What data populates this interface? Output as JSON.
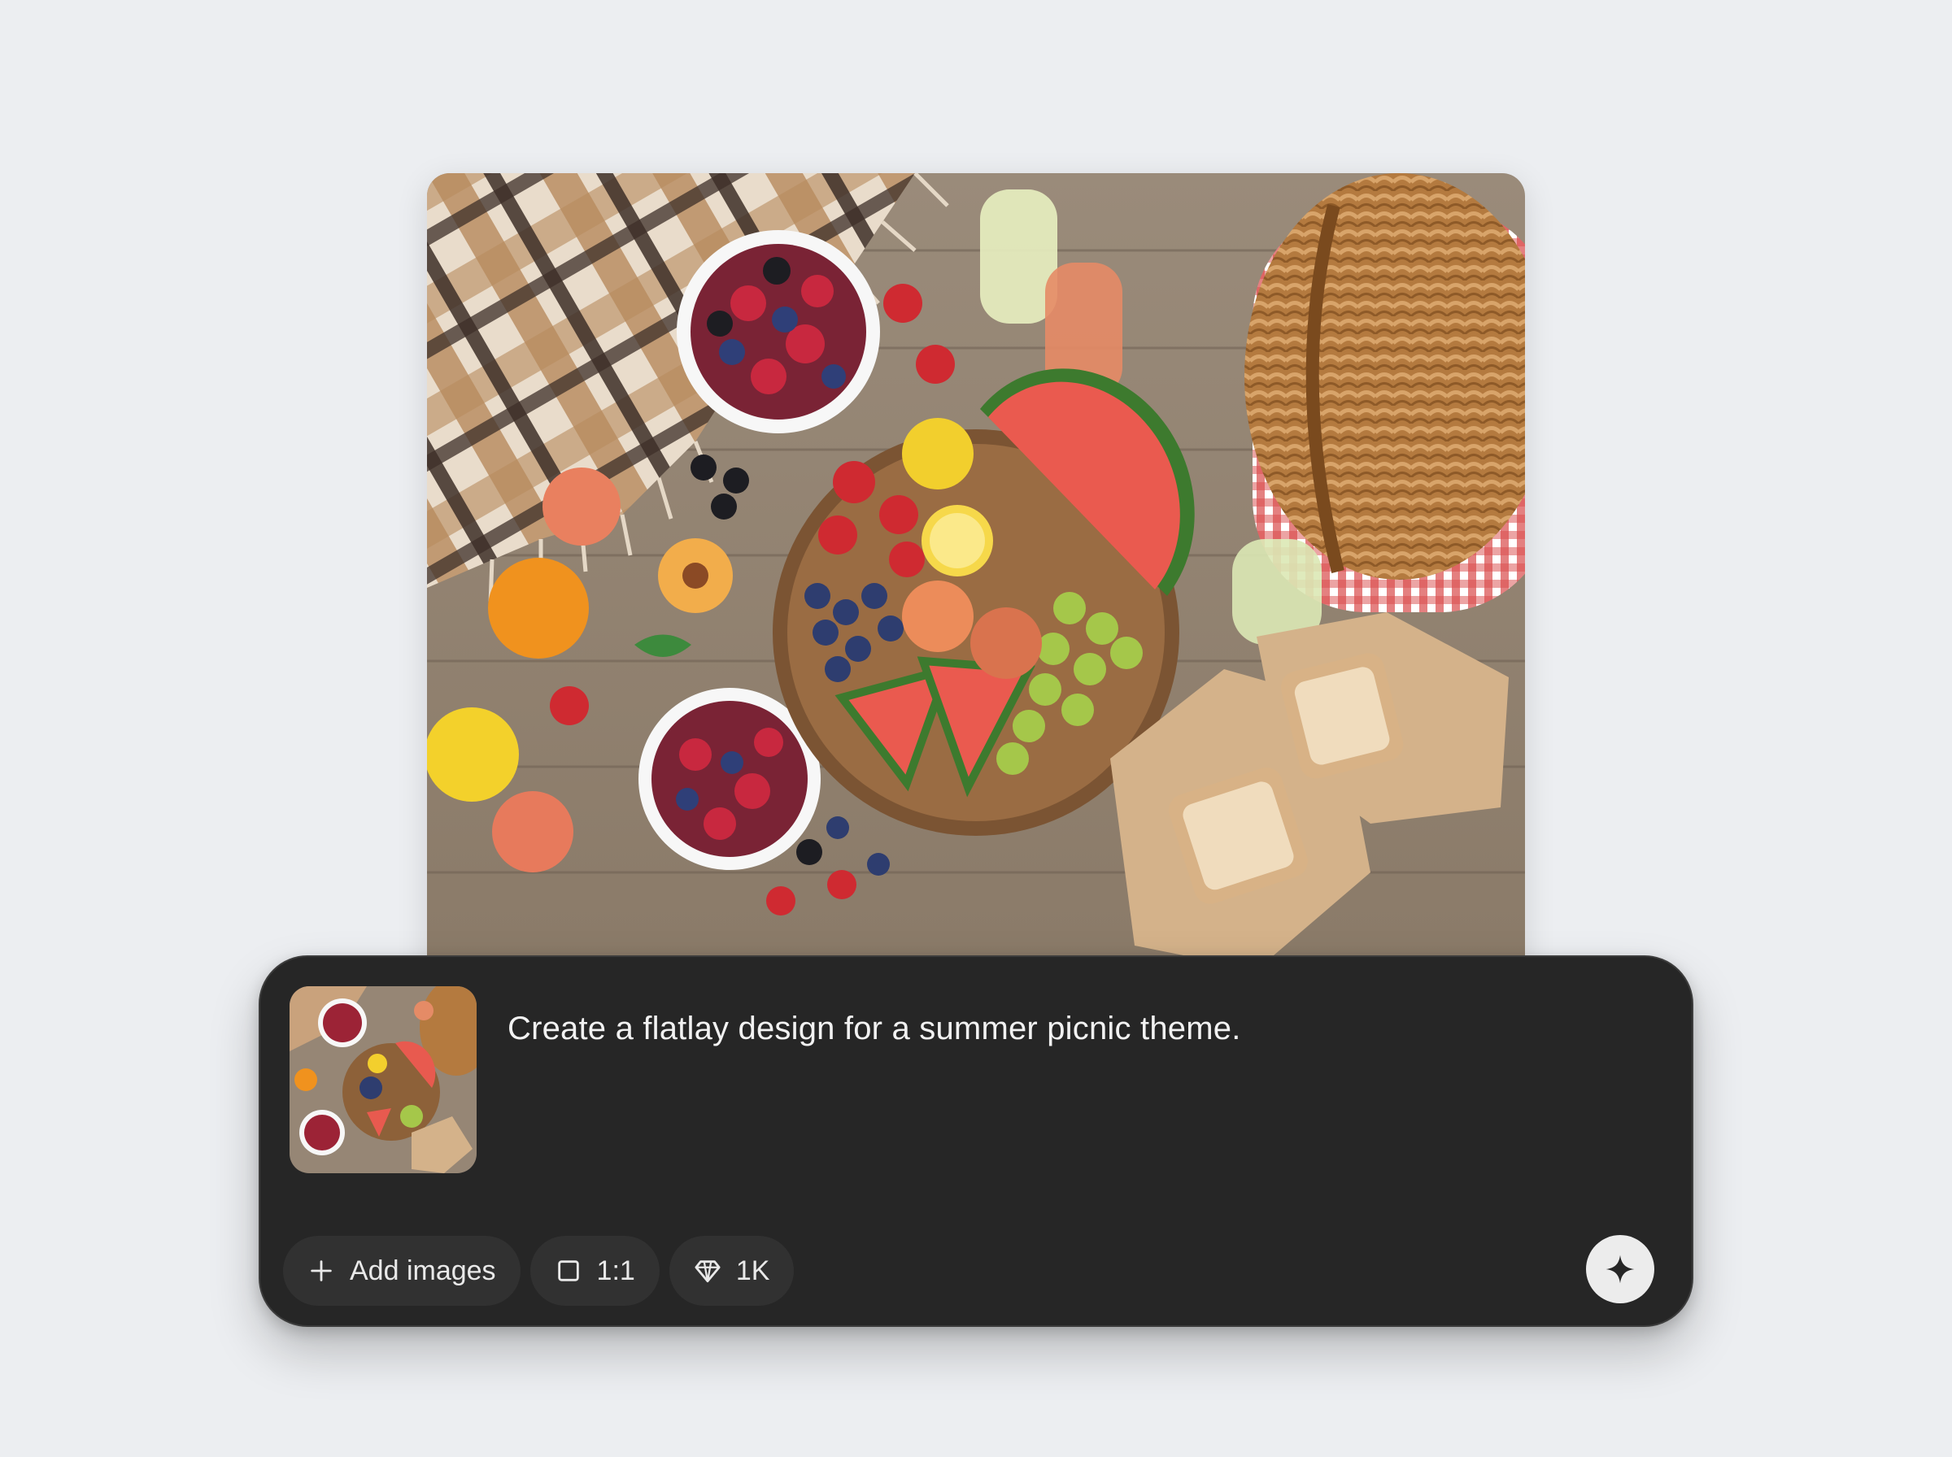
{
  "generated_image": {
    "alt_icon": "picnic-flatlay-image"
  },
  "prompt": {
    "thumbnail_icon": "picnic-flatlay-thumbnail",
    "text": "Create a flatlay design for a summer picnic theme."
  },
  "controls": {
    "add_images_label": "Add images",
    "add_images_icon": "plus-icon",
    "aspect_ratio_label": "1:1",
    "aspect_ratio_icon": "square-icon",
    "quality_label": "1K",
    "quality_icon": "diamond-icon",
    "submit_icon": "sparkle-icon"
  },
  "colors": {
    "background": "#eceef1",
    "panel": "#262626",
    "chip": "#313131",
    "submit_button": "#ececec"
  }
}
